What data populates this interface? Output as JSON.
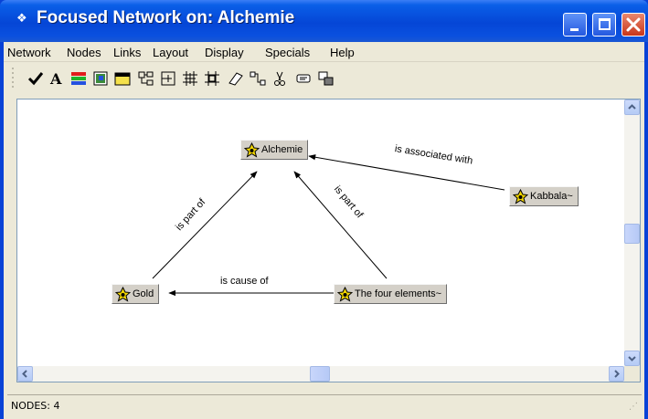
{
  "window": {
    "title": "Focused Network on: Alchemie",
    "title_icon": "network-app-icon",
    "buttons": [
      "minimize-icon",
      "maximize-icon",
      "close-icon"
    ]
  },
  "menubar": {
    "items": [
      "Network",
      "Nodes",
      "Links",
      "Layout",
      "Display",
      "Specials",
      "Help"
    ]
  },
  "toolbar": {
    "tools": [
      "check-icon",
      "font-icon",
      "color-bars-icon",
      "image-node-icon",
      "window-icon",
      "tree-layout-icon",
      "expand-icon",
      "grid-layout-icon",
      "cluster-icon",
      "eraser-icon",
      "link-icon",
      "cut-icon",
      "note-icon",
      "copy-icon"
    ]
  },
  "graph": {
    "nodes": [
      {
        "id": "alchemie",
        "label": "Alchemie",
        "icon": "star-node-icon"
      },
      {
        "id": "kabbala",
        "label": "Kabbala~",
        "icon": "star-node-icon"
      },
      {
        "id": "gold",
        "label": "Gold",
        "icon": "star-node-icon"
      },
      {
        "id": "four",
        "label": "The four elements~",
        "icon": "star-node-icon"
      }
    ],
    "edges": [
      {
        "from": "kabbala",
        "to": "alchemie",
        "label": "is associated with"
      },
      {
        "from": "gold",
        "to": "alchemie",
        "label": "is part of"
      },
      {
        "from": "four",
        "to": "alchemie",
        "label": "is part of"
      },
      {
        "from": "four",
        "to": "gold",
        "label": "is cause of"
      }
    ]
  },
  "scrollbars": {
    "icons": [
      "scroll-up-icon",
      "scroll-down-icon",
      "scroll-left-icon",
      "scroll-right-icon"
    ]
  },
  "statusbar": {
    "text": "NODES: 4"
  },
  "colors": {
    "titlebar": "#0546d6",
    "node_background": "#d4d0c8",
    "node_icon": "#f2d600",
    "close_button": "#d4461f"
  }
}
